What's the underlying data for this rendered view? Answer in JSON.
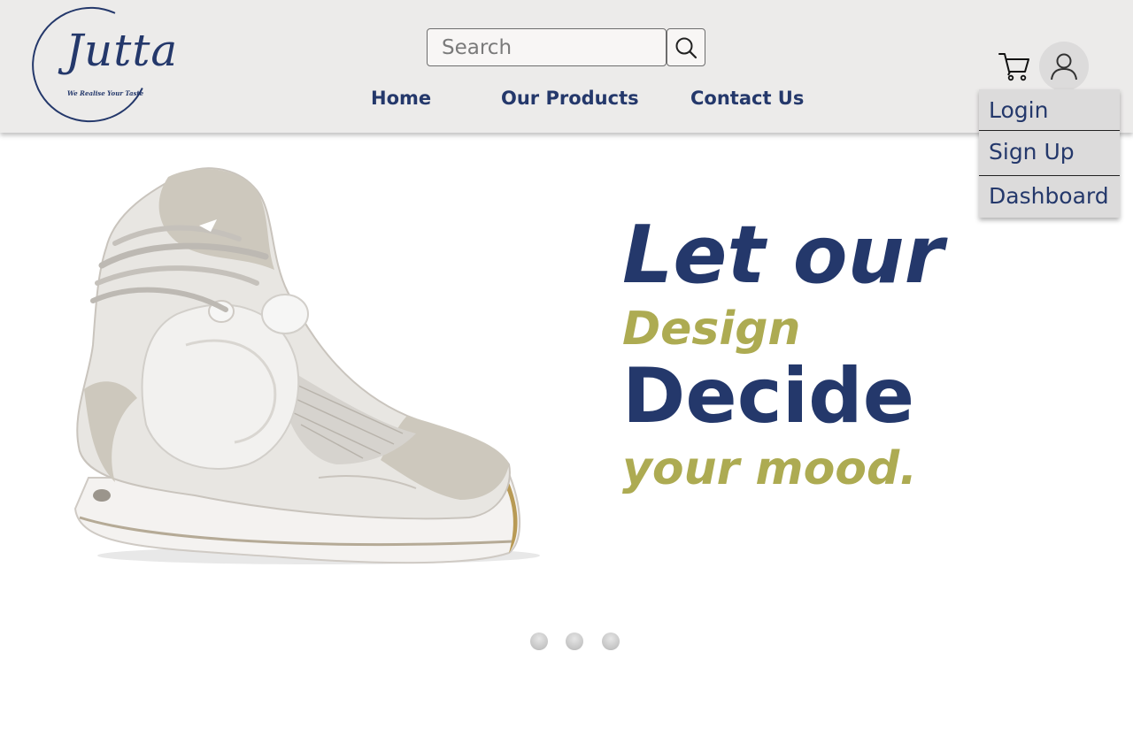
{
  "brand": {
    "name": "Jutta",
    "tagline": "We Realise Your Taste",
    "color": "#24386b",
    "accent": "#adab52"
  },
  "search": {
    "placeholder": "Search",
    "value": "",
    "button_icon": "search-icon"
  },
  "nav": {
    "items": [
      {
        "label": "Home"
      },
      {
        "label": "Our Products"
      },
      {
        "label": "Contact Us"
      }
    ]
  },
  "header_icons": {
    "cart": "cart-icon",
    "account": "user-icon"
  },
  "account_menu": {
    "items": [
      {
        "label": "Login"
      },
      {
        "label": "Sign Up"
      },
      {
        "label": "Dashboard"
      }
    ]
  },
  "hero": {
    "image": "sneaker-image",
    "line1": "Let our",
    "line2": "Design",
    "line3": "Decide",
    "line4": "your mood."
  },
  "carousel": {
    "slides": 3
  }
}
